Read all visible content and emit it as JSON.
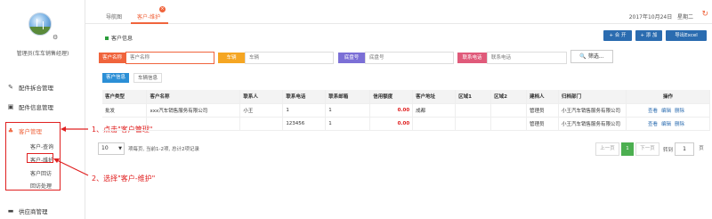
{
  "sidebar": {
    "user_name": "管理员(车车销售经理)",
    "menu": [
      {
        "label": "配件拆合管理",
        "icon": "wrench-icon"
      },
      {
        "label": "配件信息管理",
        "icon": "cube-icon"
      },
      {
        "label": "客户管理",
        "icon": "users-icon"
      },
      {
        "label": "供应商管理",
        "icon": "briefcase-icon"
      }
    ],
    "sub_items": [
      "客户-查询",
      "客户-维护",
      "客户回访",
      "回访处理"
    ]
  },
  "annotations": {
    "step1": "1、点击\"客户管理\"",
    "step2": "2、选择\"客户-维护\""
  },
  "tabs": [
    {
      "label": "导航图"
    },
    {
      "label": "客户-维护"
    }
  ],
  "header": {
    "date": "2017年10月24日",
    "weekday": "星期二"
  },
  "section_title": "客户信息",
  "toolbar": {
    "expand": "+ 合 开",
    "add": "+ 添 加",
    "export": "导出Excel"
  },
  "filters": [
    {
      "label": "客户名称",
      "placeholder": "客户名称",
      "color": "#f0643c"
    },
    {
      "label": "车辆",
      "placeholder": "车辆",
      "color": "#f5a623"
    },
    {
      "label": "底盘号",
      "placeholder": "底盘号",
      "color": "#7b6fd6"
    },
    {
      "label": "联系电话",
      "placeholder": "联系电话",
      "color": "#e05a7a"
    }
  ],
  "filter_button": "筛选...",
  "subtabs": [
    "客户信息",
    "车辆信息"
  ],
  "table": {
    "headers": [
      "客户类型",
      "客户名称",
      "联系人",
      "联系电话",
      "联系邮箱",
      "信用额度",
      "客户地址",
      "区域1",
      "区域2",
      "建档人",
      "归档部门",
      "操作"
    ],
    "rows": [
      {
        "type": "批发",
        "name": "xxx汽车销售服务有限公司",
        "contact": "小王",
        "phone": "1",
        "email": "1",
        "credit": "0.00",
        "address": "成都",
        "area1": "",
        "area2": "",
        "creator": "管理员",
        "dept": "小王汽车销售服务有限公司",
        "ops": [
          "查看",
          "编辑",
          "删除"
        ]
      },
      {
        "type": "",
        "name": "",
        "contact": "",
        "phone": "123456",
        "email": "1",
        "credit": "0.00",
        "address": "",
        "area1": "",
        "area2": "",
        "creator": "管理员",
        "dept": "小王汽车销售服务有限公司",
        "ops": [
          "查看",
          "编辑",
          "删除"
        ]
      }
    ]
  },
  "pager": {
    "page_size": "10",
    "info": "项每页, 当前1-2项, 总计2项记录",
    "prev": "上一页",
    "current": "1",
    "next": "下一页",
    "jump_label": "转到",
    "jump_value": "1",
    "go": "页"
  },
  "colors": {
    "accent": "#f0643c",
    "primary_button": "#2b6cb0",
    "annotation": "#e02020"
  }
}
